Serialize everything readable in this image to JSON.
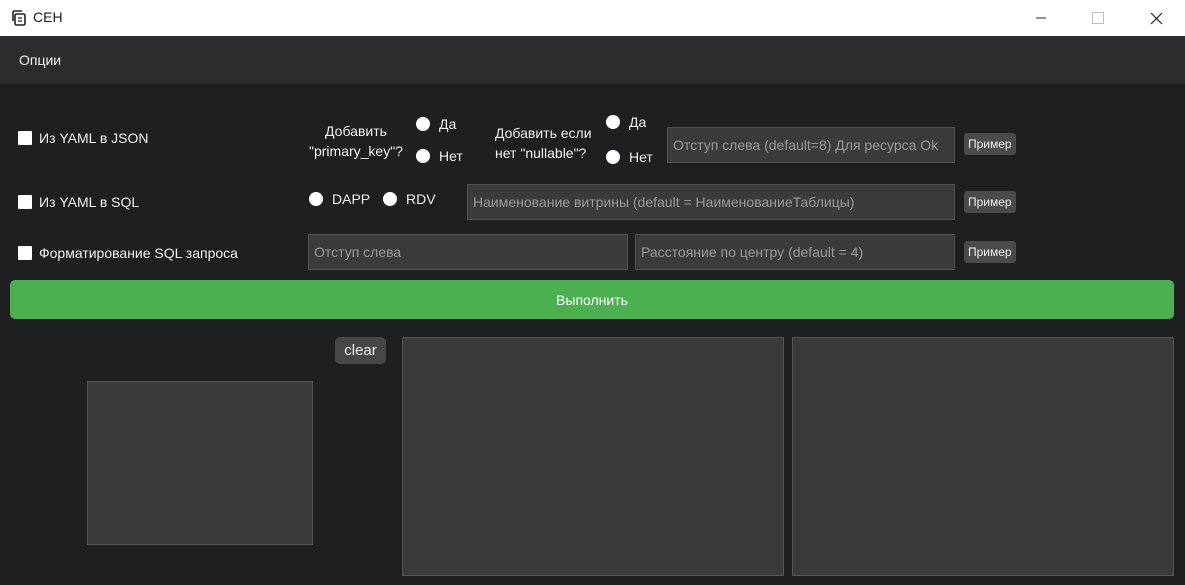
{
  "window": {
    "title": "СЕН",
    "icons": {
      "app": "copy-icon",
      "minimize": "minimize-icon",
      "maximize": "maximize-icon",
      "close": "close-icon"
    }
  },
  "menu": {
    "options": "Опции"
  },
  "rows": {
    "yaml_json": {
      "checkbox_label": "Из YAML в JSON",
      "primary_key_question_line1": "Добавить",
      "primary_key_question_line2": "\"primary_key\"?",
      "pk_yes": "Да",
      "pk_no": "Нет",
      "nullable_question_line1": "Добавить если",
      "nullable_question_line2": "нет \"nullable\"?",
      "nl_yes": "Да",
      "nl_no": "Нет",
      "indent_placeholder": "Отступ слева (default=8) Для ресурса Ok",
      "example_label": "Пример"
    },
    "yaml_sql": {
      "checkbox_label": "Из YAML в SQL",
      "radio_dapp": "DAPP",
      "radio_rdv": "RDV",
      "showcase_placeholder": "Наименование витрины (default = НаименованиеТаблицы)",
      "example_label": "Пример"
    },
    "sql_format": {
      "checkbox_label": "Форматирование SQL запроса",
      "indent_placeholder": "Отступ слева",
      "center_placeholder": "Расстояние по центру (default = 4)",
      "example_label": "Пример"
    }
  },
  "run_button": "Выполнить",
  "clear_button": "clear",
  "colors": {
    "accent": "#4caf50",
    "background": "#1e1f21",
    "panel": "#3a3b3d"
  }
}
